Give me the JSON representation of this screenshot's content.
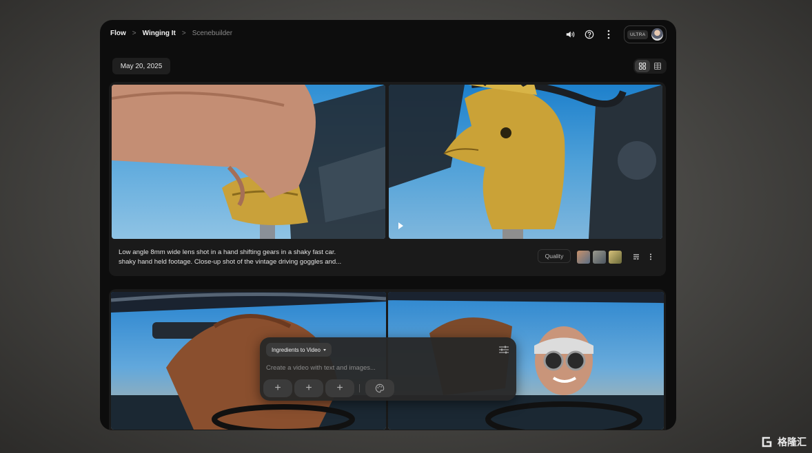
{
  "breadcrumb": {
    "items": [
      "Flow",
      "Winging It",
      "Scenebuilder"
    ],
    "separator": ">"
  },
  "header": {
    "plan_badge": "ULTRA",
    "icons": [
      "volume-icon",
      "help-icon",
      "more-vert-icon"
    ]
  },
  "date_label": "May 20, 2025",
  "view_toggle": {
    "options": [
      "grid-view-icon",
      "list-view-icon"
    ],
    "selected": "grid-view-icon"
  },
  "clip_card": {
    "caption_line1": "Low angle 8mm wide lens shot in a hand shifting gears in a shaky fast car.",
    "caption_line2": "shaky hand held footage. Close-up shot of the vintage driving goggles and...",
    "quality_label": "Quality",
    "ingredient_thumbnails": 3
  },
  "composer": {
    "mode_label": "Ingredients to Video",
    "placeholder": "Create a video with text and images...",
    "add_slots": [
      "+",
      "+",
      "+"
    ]
  },
  "watermark": "格隆汇",
  "colors": {
    "frame_bg": "#0d0d0d",
    "card_bg": "#1a1a1a",
    "chip_bg": "#1f1f1f",
    "composer_bg": "#282828",
    "brass": "#c9a13a"
  }
}
